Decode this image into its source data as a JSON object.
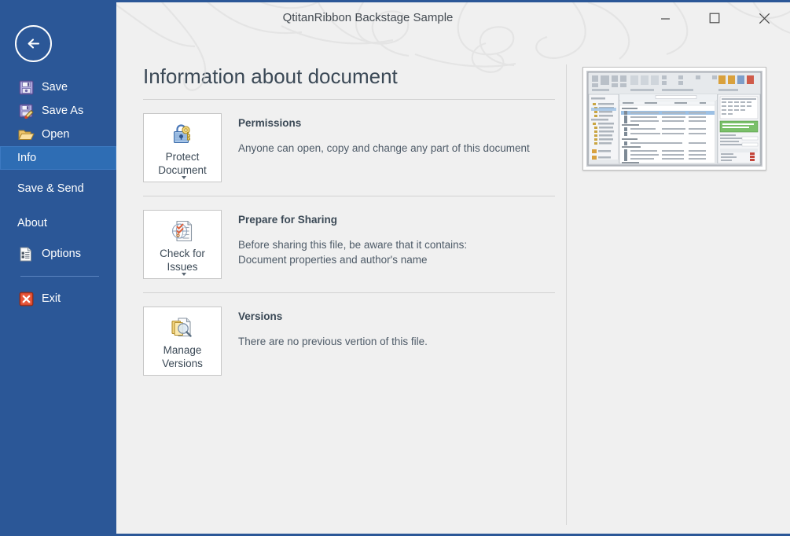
{
  "window": {
    "title": "QtitanRibbon Backstage Sample",
    "controls": {
      "minimize": "Minimize",
      "maximize": "Maximize",
      "close": "Close"
    },
    "accent_color": "#2b5797",
    "selected_color": "#2e6db4",
    "background_color": "#f0f0f0"
  },
  "sidebar": {
    "back_label": "Back",
    "items": [
      {
        "label": "Save",
        "icon": "floppy-disk-icon",
        "has_icon": true,
        "selected": false
      },
      {
        "label": "Save As",
        "icon": "floppy-disk-pencil-icon",
        "has_icon": true,
        "selected": false
      },
      {
        "label": "Open",
        "icon": "open-folder-icon",
        "has_icon": true,
        "selected": false
      },
      {
        "label": "Info",
        "icon": "",
        "has_icon": false,
        "selected": true
      },
      {
        "label": "Save & Send",
        "icon": "",
        "has_icon": false,
        "selected": false
      },
      {
        "label": "About",
        "icon": "",
        "has_icon": false,
        "selected": false
      },
      {
        "label": "Options",
        "icon": "options-document-icon",
        "has_icon": true,
        "selected": false
      },
      {
        "label": "Exit",
        "icon": "red-x-icon",
        "has_icon": true,
        "selected": false
      }
    ]
  },
  "main": {
    "page_title": "Information about document",
    "sections": [
      {
        "button_label": "Protect\nDocument",
        "button_icon": "lock-key-icon",
        "button_has_caret": true,
        "heading": "Permissions",
        "body": "Anyone can open, copy and change any part of this document"
      },
      {
        "button_label": "Check for\nIssues",
        "button_icon": "document-checklist-icon",
        "button_has_caret": true,
        "heading": "Prepare for Sharing",
        "body": "Before sharing this file, be aware that it contains:\nDocument properties and author's name"
      },
      {
        "button_label": "Manage\nVersions",
        "button_icon": "documents-magnifier-icon",
        "button_has_caret": false,
        "heading": "Versions",
        "body": "There are no previous vertion of this file."
      }
    ],
    "preview": {
      "name": "document-thumbnail",
      "alt": "Document preview thumbnail"
    }
  }
}
